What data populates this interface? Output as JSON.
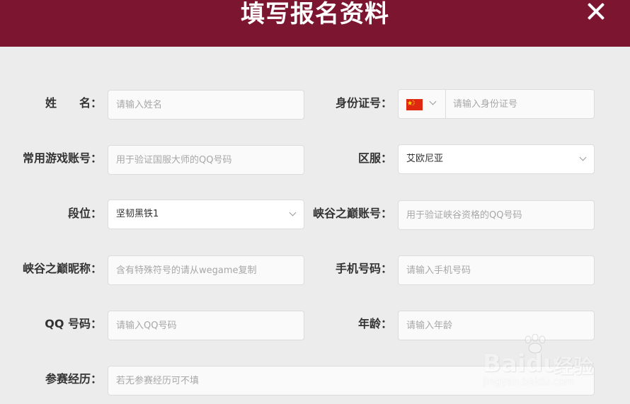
{
  "header": {
    "title": "填写报名资料",
    "close_icon": "close-icon"
  },
  "colors": {
    "header_bg": "#7c1630",
    "page_bg": "#ececec",
    "field_bg": "#fafafa"
  },
  "form": {
    "name": {
      "label": "姓　　名：",
      "placeholder": "请输入姓名"
    },
    "id_number": {
      "label": "身份证号：",
      "country_flag": "china-flag-icon",
      "placeholder": "请输入身份证号"
    },
    "game_account": {
      "label": "常用游戏账号：",
      "placeholder": "用于验证国服大师的QQ号码"
    },
    "server": {
      "label": "区服：",
      "value": "艾欧尼亚"
    },
    "rank": {
      "label": "段位：",
      "value": "坚韧黑铁1"
    },
    "canyon_account": {
      "label": "峡谷之巅账号：",
      "placeholder": "用于验证峡谷资格的QQ号码"
    },
    "canyon_nickname": {
      "label": "峡谷之巅昵称：",
      "placeholder": "含有特殊符号的请从wegame复制"
    },
    "phone": {
      "label": "手机号码：",
      "placeholder": "请输入手机号码"
    },
    "qq": {
      "label": "QQ 号码：",
      "placeholder": "请输入QQ号码"
    },
    "age": {
      "label": "年龄：",
      "placeholder": "请输入年龄"
    },
    "experience": {
      "label": "参赛经历：",
      "placeholder": "若无参赛经历可不填"
    }
  },
  "watermark": {
    "logo": "Bai",
    "logo2": "du",
    "cn": "经验",
    "url": "jingyan.baidu.com"
  }
}
